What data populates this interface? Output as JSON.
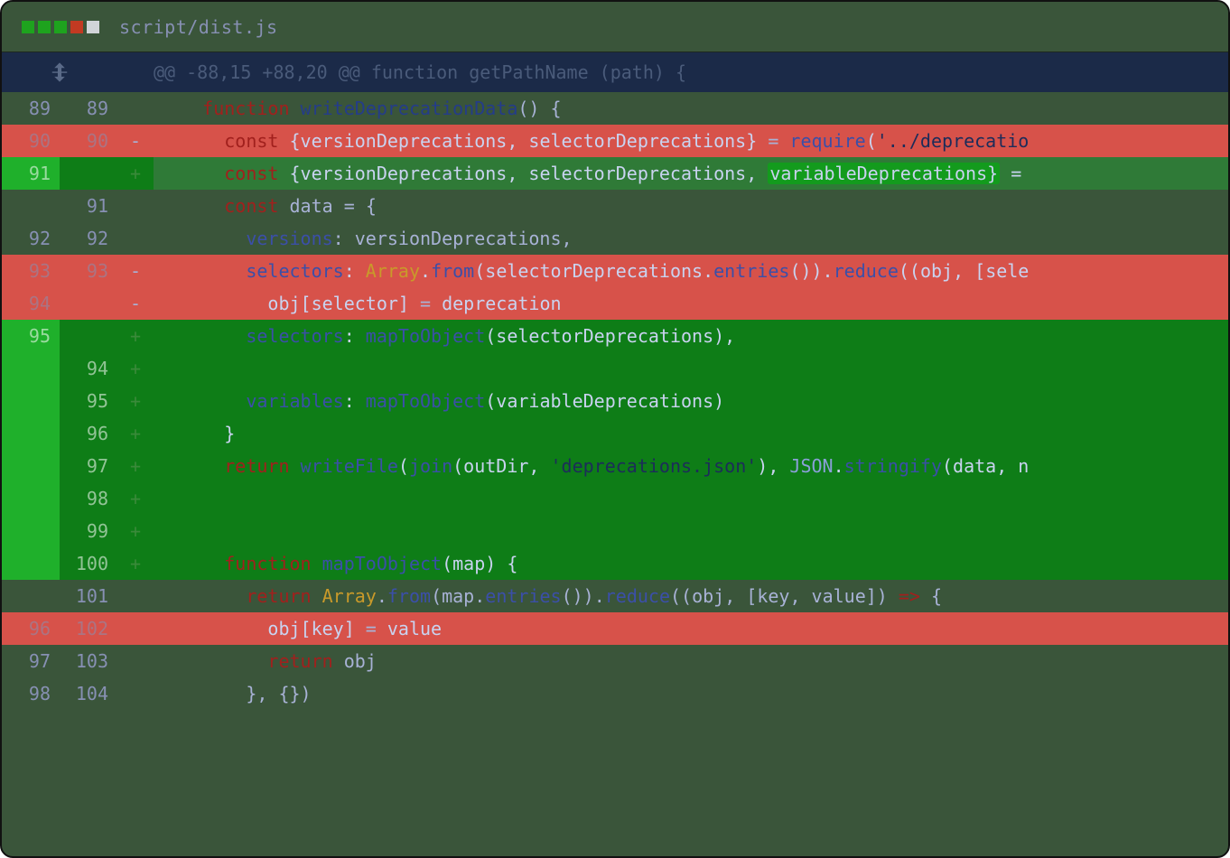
{
  "title": "script/dist.js",
  "hunk_header": "@@ -88,15 +88,20 @@ function getPathName (path) {",
  "rows": [
    {
      "old": "89",
      "new": "89",
      "mark": " ",
      "bg": "ctx",
      "tokens": [
        {
          "cls": "tk-kw",
          "t": "    function "
        },
        {
          "cls": "tk-fn",
          "t": "writeDeprecationData"
        },
        {
          "cls": "tk-plain",
          "t": "() {"
        }
      ]
    },
    {
      "old": "90",
      "new": "90",
      "mark": "-",
      "bg": "del",
      "tokens": [
        {
          "cls": "tk-kw",
          "t": "      const "
        },
        {
          "cls": "tk-plainD",
          "t": "{versionDeprecations, selectorDeprecations} "
        },
        {
          "cls": "tk-op",
          "t": "= "
        },
        {
          "cls": "tk-decl",
          "t": "require"
        },
        {
          "cls": "tk-plainD",
          "t": "("
        },
        {
          "cls": "tk-str",
          "t": "'../deprecatio"
        }
      ]
    },
    {
      "old": "91",
      "new": "",
      "mark": "+",
      "bg": "add-gut-ltcode",
      "tokens": [
        {
          "cls": "tk-kw",
          "t": "      const "
        },
        {
          "cls": "tk-plainD",
          "t": "{versionDeprecations, selectorDeprecations, "
        },
        {
          "cls": "tk-plainD hl-add",
          "t": "variableDeprecations}"
        },
        {
          "cls": "tk-plainD",
          "t": " ="
        }
      ]
    },
    {
      "old": "",
      "new": "91",
      "mark": " ",
      "bg": "ctx",
      "tokens": [
        {
          "cls": "tk-kw",
          "t": "      const "
        },
        {
          "cls": "tk-plain",
          "t": "data "
        },
        {
          "cls": "tk-op",
          "t": "= "
        },
        {
          "cls": "tk-plain",
          "t": "{"
        }
      ]
    },
    {
      "old": "92",
      "new": "92",
      "mark": " ",
      "bg": "ctx",
      "tokens": [
        {
          "cls": "tk-key",
          "t": "        versions"
        },
        {
          "cls": "tk-plain",
          "t": ": versionDeprecations,"
        }
      ]
    },
    {
      "old": "93",
      "new": "93",
      "mark": "-",
      "bg": "del",
      "tokens": [
        {
          "cls": "tk-key",
          "t": "        selectors"
        },
        {
          "cls": "tk-plainD",
          "t": ": "
        },
        {
          "cls": "tk-cls",
          "t": "Array"
        },
        {
          "cls": "tk-plainD",
          "t": "."
        },
        {
          "cls": "tk-decl",
          "t": "from"
        },
        {
          "cls": "tk-plainD",
          "t": "(selectorDeprecations."
        },
        {
          "cls": "tk-decl",
          "t": "entries"
        },
        {
          "cls": "tk-plainD",
          "t": "())."
        },
        {
          "cls": "tk-decl",
          "t": "reduce"
        },
        {
          "cls": "tk-plainD",
          "t": "((obj, [sele"
        }
      ]
    },
    {
      "old": "94",
      "new": "",
      "mark": "-",
      "bg": "del",
      "tokens": [
        {
          "cls": "tk-plainD",
          "t": "          obj[selector] "
        },
        {
          "cls": "tk-op",
          "t": "= "
        },
        {
          "cls": "tk-plainD",
          "t": "deprecation"
        }
      ]
    },
    {
      "old": "95",
      "new": "",
      "mark": "+",
      "bg": "add-gut-dkcode",
      "tokens": [
        {
          "cls": "tk-key",
          "t": "        selectors"
        },
        {
          "cls": "tk-plainD",
          "t": ": "
        },
        {
          "cls": "tk-decl",
          "t": "mapToObject"
        },
        {
          "cls": "tk-plainD",
          "t": "(selectorDeprecations),"
        }
      ]
    },
    {
      "old": "",
      "new": "94",
      "mark": "+",
      "bg": "add-full",
      "tokens": [
        {
          "cls": "tk-plainD",
          "t": ""
        }
      ]
    },
    {
      "old": "",
      "new": "95",
      "mark": "+",
      "bg": "add-full",
      "tokens": [
        {
          "cls": "tk-key",
          "t": "        variables"
        },
        {
          "cls": "tk-plainD",
          "t": ": "
        },
        {
          "cls": "tk-decl",
          "t": "mapToObject"
        },
        {
          "cls": "tk-plainD",
          "t": "(variableDeprecations)"
        }
      ]
    },
    {
      "old": "",
      "new": "96",
      "mark": "+",
      "bg": "add-full",
      "tokens": [
        {
          "cls": "tk-plainD",
          "t": "      }"
        }
      ]
    },
    {
      "old": "",
      "new": "97",
      "mark": "+",
      "bg": "add-full",
      "tokens": [
        {
          "cls": "tk-kw",
          "t": "      return "
        },
        {
          "cls": "tk-decl",
          "t": "writeFile"
        },
        {
          "cls": "tk-plainD",
          "t": "("
        },
        {
          "cls": "tk-decl",
          "t": "join"
        },
        {
          "cls": "tk-plainD",
          "t": "(outDir, "
        },
        {
          "cls": "tk-str",
          "t": "'deprecations.json'"
        },
        {
          "cls": "tk-plainD",
          "t": "), "
        },
        {
          "cls": "tk-pale",
          "t": "JSON"
        },
        {
          "cls": "tk-plainD",
          "t": "."
        },
        {
          "cls": "tk-decl",
          "t": "stringify"
        },
        {
          "cls": "tk-plainD",
          "t": "(data, n"
        }
      ]
    },
    {
      "old": "",
      "new": "98",
      "mark": "+",
      "bg": "add-full",
      "tokens": [
        {
          "cls": "tk-plainD",
          "t": ""
        }
      ]
    },
    {
      "old": "",
      "new": "99",
      "mark": "+",
      "bg": "add-full",
      "tokens": [
        {
          "cls": "tk-plainD",
          "t": ""
        }
      ]
    },
    {
      "old": "",
      "new": "100",
      "mark": "+",
      "bg": "add-full",
      "tokens": [
        {
          "cls": "tk-kw",
          "t": "      function "
        },
        {
          "cls": "tk-decl",
          "t": "mapToObject"
        },
        {
          "cls": "tk-plainD",
          "t": "(map) {"
        }
      ]
    },
    {
      "old": "",
      "new": "101",
      "mark": " ",
      "bg": "ctx",
      "tokens": [
        {
          "cls": "tk-kw",
          "t": "        return "
        },
        {
          "cls": "tk-cls",
          "t": "Array"
        },
        {
          "cls": "tk-plain",
          "t": "."
        },
        {
          "cls": "tk-decl",
          "t": "from"
        },
        {
          "cls": "tk-plain",
          "t": "(map."
        },
        {
          "cls": "tk-decl",
          "t": "entries"
        },
        {
          "cls": "tk-plain",
          "t": "())."
        },
        {
          "cls": "tk-decl",
          "t": "reduce"
        },
        {
          "cls": "tk-plain",
          "t": "((obj, [key, value]) "
        },
        {
          "cls": "tk-kw",
          "t": "=>"
        },
        {
          "cls": "tk-plain",
          "t": " {"
        }
      ]
    },
    {
      "old": "96",
      "new": "102",
      "mark": " ",
      "bg": "del",
      "tokens": [
        {
          "cls": "tk-plainD",
          "t": "          obj[key] "
        },
        {
          "cls": "tk-op",
          "t": "= "
        },
        {
          "cls": "tk-plainD",
          "t": "value"
        }
      ]
    },
    {
      "old": "97",
      "new": "103",
      "mark": " ",
      "bg": "ctx",
      "tokens": [
        {
          "cls": "tk-kw",
          "t": "          return "
        },
        {
          "cls": "tk-plain",
          "t": "obj"
        }
      ]
    },
    {
      "old": "98",
      "new": "104",
      "mark": " ",
      "bg": "ctx",
      "tokens": [
        {
          "cls": "tk-plain",
          "t": "        }, {})"
        }
      ]
    }
  ]
}
